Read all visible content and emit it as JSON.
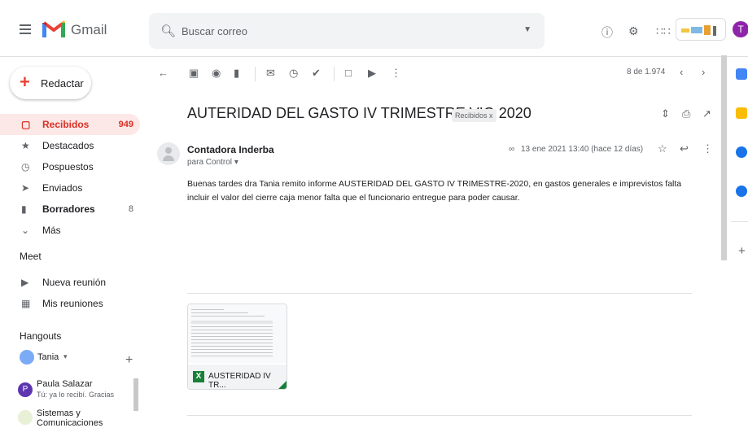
{
  "header": {
    "app_name": "Gmail",
    "search_placeholder": "Buscar correo",
    "account_initial": "T"
  },
  "sidebar": {
    "compose_label": "Redactar",
    "items": [
      {
        "label": "Recibidos",
        "count": "949",
        "icon": "inbox-icon",
        "active": true
      },
      {
        "label": "Destacados",
        "count": "",
        "icon": "star-icon"
      },
      {
        "label": "Pospuestos",
        "count": "",
        "icon": "clock-icon"
      },
      {
        "label": "Enviados",
        "count": "",
        "icon": "send-icon"
      },
      {
        "label": "Borradores",
        "count": "8",
        "icon": "draft-icon"
      },
      {
        "label": "Más",
        "count": "",
        "icon": "chevron-down-icon"
      }
    ],
    "meet": {
      "title": "Meet",
      "new_meeting": "Nueva reunión",
      "my_meetings": "Mis reuniones"
    },
    "hangouts": {
      "title": "Hangouts",
      "user": "Tania",
      "contacts": [
        {
          "name": "Paula Salazar",
          "status": "Tú: ya lo recibí. Gracias",
          "initial": "P"
        },
        {
          "name": "Sistemas y Comunicaciones",
          "status": ""
        }
      ]
    }
  },
  "toolbar": {
    "pager": "8 de 1.974"
  },
  "message": {
    "subject": "AUTERIDAD DEL GASTO IV TRIMESTRE VIG 2020",
    "label_chip": "Recibidos x",
    "sender": "Contadora Inderba",
    "to": "para Control",
    "date": "13 ene 2021 13:40 (hace 12 días)",
    "body": "Buenas tardes dra Tania remito informe  AUSTERIDAD DEL GASTO IV TRIMESTRE-2020, en gastos generales e imprevistos falta incluir el valor del cierre caja menor falta que el funcionario entregue para poder causar.",
    "attachment_name": "AUSTERIDAD IV TR...",
    "attachment_type": "X"
  },
  "colors": {
    "accent_red": "#d93025",
    "active_bg": "#fce8e6",
    "excel_green": "#188038",
    "avatar_purple": "#8e24aa"
  }
}
